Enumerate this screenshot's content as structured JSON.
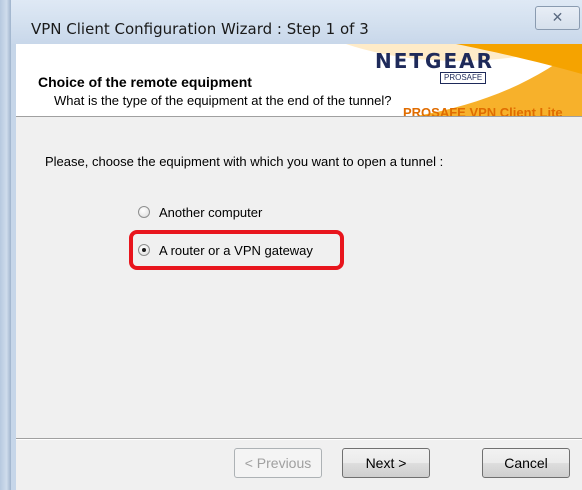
{
  "window": {
    "title": "VPN Client Configuration Wizard : Step 1 of 3",
    "close_label": "☒"
  },
  "header": {
    "title": "Choice of the remote equipment",
    "subtitle": "What is the type of the equipment at the end of the tunnel?",
    "brand": "NETGEAR",
    "brand_badge": "PROSAFE",
    "product": "PROSAFE VPN Client Lite"
  },
  "content": {
    "prompt": "Please, choose the equipment with which you want to open a tunnel :",
    "options": [
      {
        "label": "Another computer",
        "checked": false
      },
      {
        "label": "A router or a VPN gateway",
        "checked": true
      }
    ]
  },
  "buttons": {
    "previous": "< Previous",
    "next": "Next >",
    "cancel": "Cancel"
  },
  "colors": {
    "highlight": "#e8151d",
    "brand_orange": "#f5a300",
    "product_text": "#e06c00"
  }
}
